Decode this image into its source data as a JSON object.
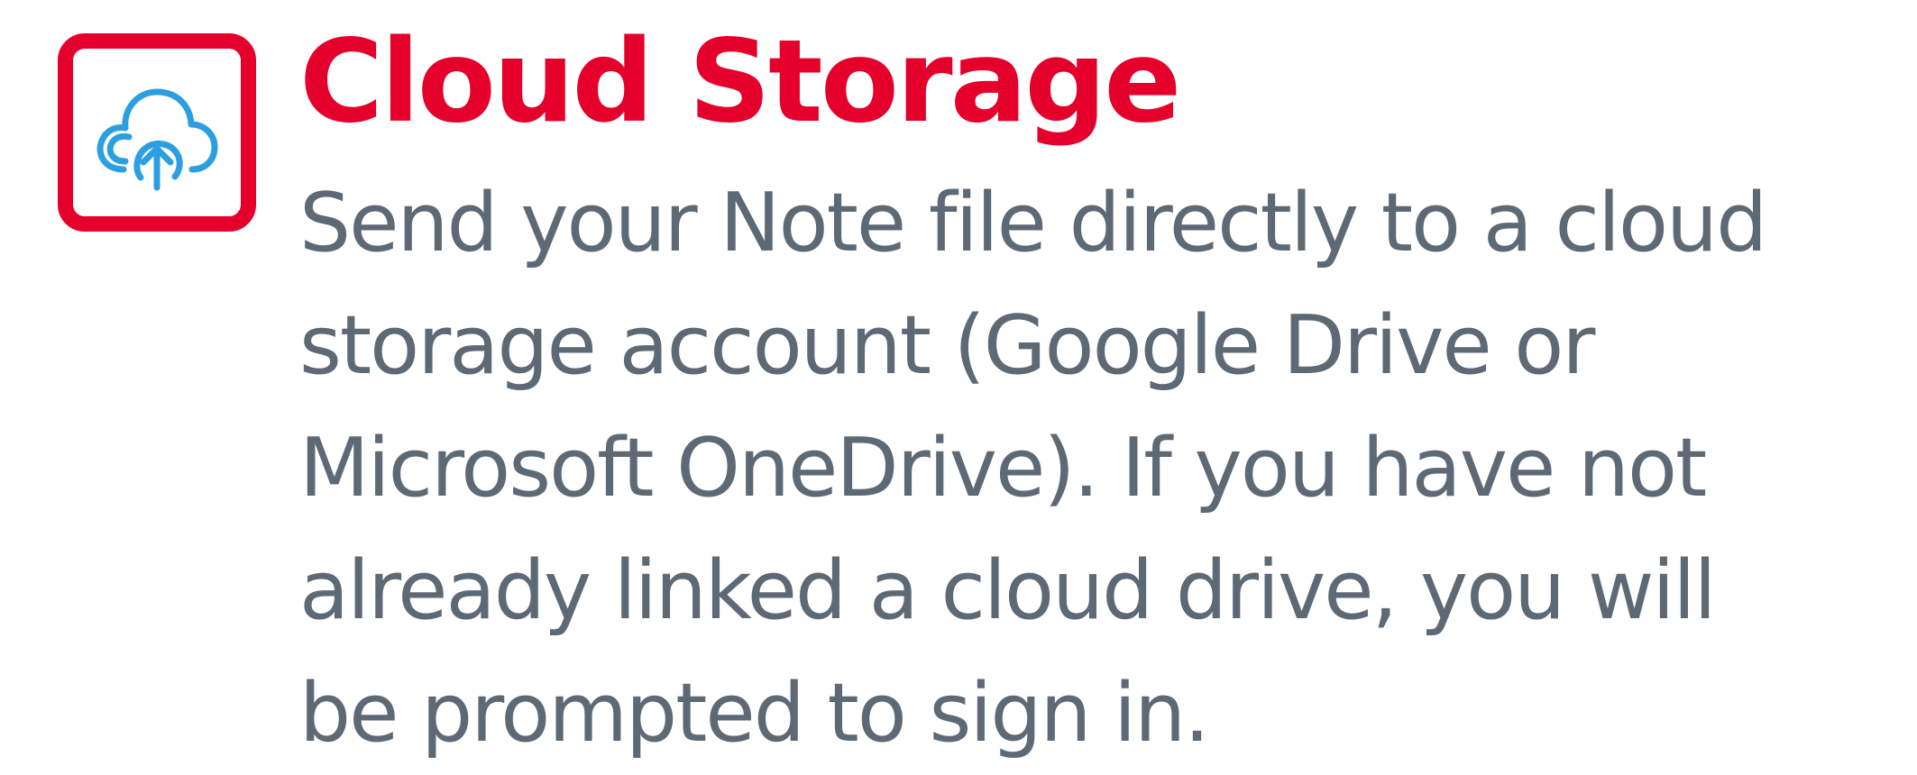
{
  "colors": {
    "accent": "#e4002b",
    "text": "#5d6975",
    "icon": "#2c9fe0"
  },
  "icon": "cloud-upload-icon",
  "title": "Cloud Storage",
  "description_lines": [
    "Send your Note file directly to a cloud",
    "storage account (Google Drive or",
    "Microsoft OneDrive). If you have not",
    "already linked a cloud drive, you will",
    "be prompted to sign in."
  ]
}
